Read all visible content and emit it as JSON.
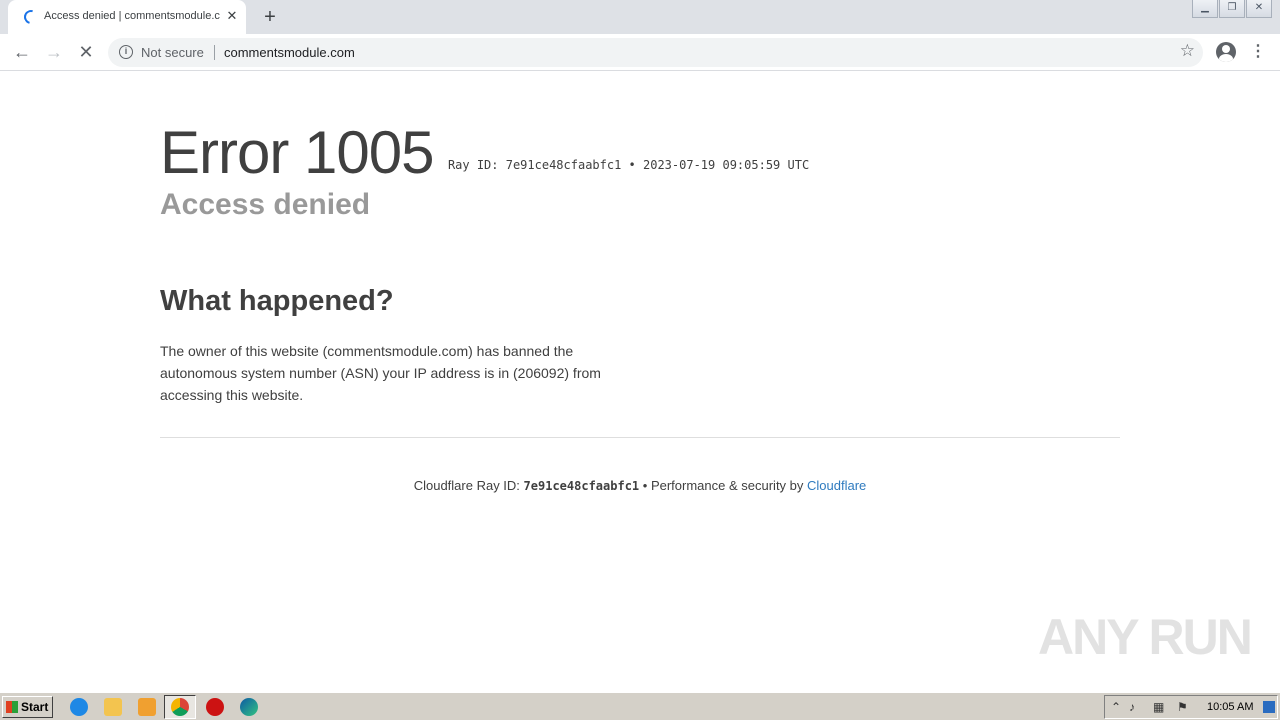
{
  "browser": {
    "tab": {
      "title": "Access denied | commentsmodule.com"
    },
    "new_tab_symbol": "+",
    "omnibox": {
      "security_label": "Not secure",
      "url": "commentsmodule.com"
    }
  },
  "page": {
    "error_title": "Error 1005",
    "ray_meta": "Ray ID: 7e91ce48cfaabfc1 • 2023-07-19 09:05:59 UTC",
    "subtitle": "Access denied",
    "section_title": "What happened?",
    "explanation": "The owner of this website (commentsmodule.com) has banned the autonomous system number (ASN) your IP address is in (206092) from accessing this website.",
    "footer": {
      "ray_label": "Cloudflare Ray ID:",
      "ray_id": "7e91ce48cfaabfc1",
      "separator": "•",
      "perf_label": "Performance & security by",
      "provider_link": "Cloudflare",
      "link_color": "#2f7bbf"
    },
    "watermark": "ANY RUN"
  },
  "taskbar": {
    "start_label": "Start",
    "clock": "10:05 AM",
    "pinned": [
      "internet-explorer-icon",
      "file-explorer-icon",
      "media-player-icon",
      "chrome-icon",
      "opera-icon",
      "edge-icon"
    ]
  }
}
